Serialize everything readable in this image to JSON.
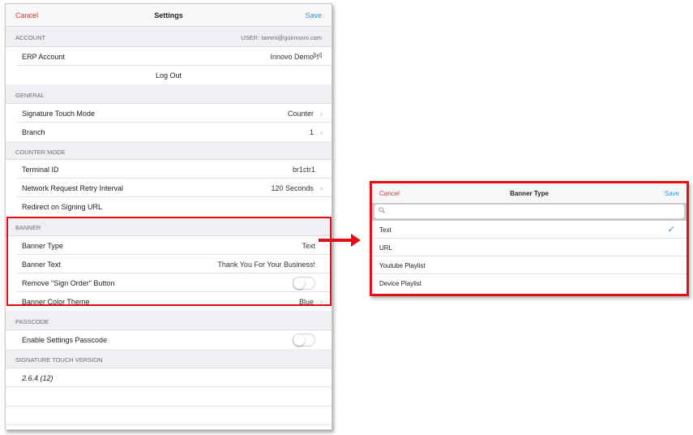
{
  "settings": {
    "nav": {
      "cancel": "Cancel",
      "title": "Settings",
      "save": "Save"
    },
    "account": {
      "header": "ACCOUNT",
      "user": "USER: tammi@goinnovo.com",
      "erp_label": "ERP Account",
      "erp_value": "Innovo Demo",
      "logout": "Log Out"
    },
    "general": {
      "header": "GENERAL",
      "mode_label": "Signature Touch Mode",
      "mode_value": "Counter",
      "branch_label": "Branch",
      "branch_value": "1"
    },
    "counter": {
      "header": "COUNTER MODE",
      "terminal_label": "Terminal ID",
      "terminal_value": "br1ctr1",
      "retry_label": "Network Request Retry Interval",
      "retry_value": "120 Seconds",
      "redirect_label": "Redirect on Signing URL"
    },
    "banner": {
      "header": "BANNER",
      "type_label": "Banner Type",
      "type_value": "Text",
      "text_label": "Banner Text",
      "text_value": "Thank You For Your Business!",
      "remove_label": "Remove \"Sign Order\" Button",
      "remove_on": false,
      "color_label": "Banner Color Theme",
      "color_value": "Blue"
    },
    "passcode": {
      "header": "PASSCODE",
      "enable_label": "Enable Settings Passcode",
      "enable_on": false
    },
    "version": {
      "header": "SIGNATURE TOUCH VERSION",
      "value": "2.6.4 (12)"
    }
  },
  "banner_type_popup": {
    "nav": {
      "cancel": "Cancel",
      "title": "Banner Type",
      "save": "Save"
    },
    "search": {
      "value": "",
      "placeholder": ""
    },
    "options": [
      {
        "label": "Text",
        "selected": true
      },
      {
        "label": "URL",
        "selected": false
      },
      {
        "label": "Youtube Playlist",
        "selected": false
      },
      {
        "label": "Device Playlist",
        "selected": false
      }
    ]
  },
  "colors": {
    "highlight": "#e20f16",
    "cancel": "#e0352f",
    "accent": "#2b9bd6"
  },
  "icons": {
    "erp_status": "antenna-signal-icon",
    "disclosure": "chevron-right-icon",
    "search": "magnifier-icon",
    "selected": "checkmark-icon"
  }
}
